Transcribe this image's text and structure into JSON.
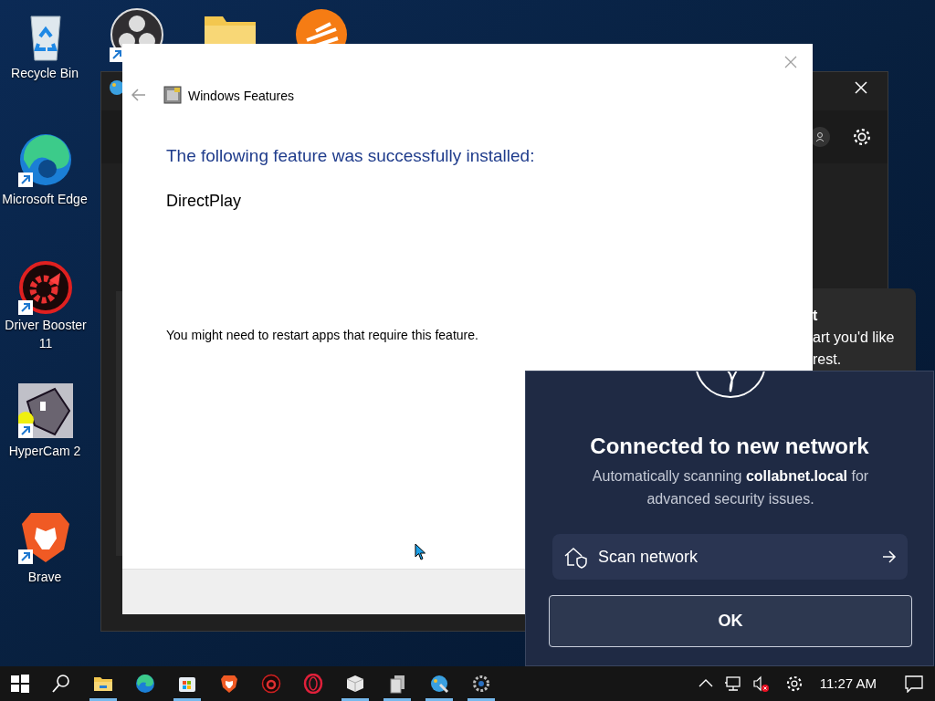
{
  "desktop": {
    "icons": [
      {
        "kind": "recycle",
        "label": "Recycle Bin",
        "shortcut": false
      },
      {
        "kind": "edge",
        "label": "Microsoft Edge",
        "shortcut": true
      },
      {
        "kind": "booster",
        "label": "Driver Booster 11",
        "shortcut": true
      },
      {
        "kind": "hypercam",
        "label": "HyperCam 2",
        "shortcut": true
      },
      {
        "kind": "brave",
        "label": "Brave",
        "shortcut": true
      },
      {
        "kind": "obs",
        "shortcut": true
      },
      {
        "kind": "folder",
        "shortcut": false
      },
      {
        "kind": "orange",
        "shortcut": false
      }
    ]
  },
  "dialog": {
    "title": "Windows Features",
    "heading": "The following feature was successfully installed:",
    "feature": "DirectPlay",
    "note": "You might need to restart apps that require this feature."
  },
  "toast": {
    "lines": [
      "t",
      "art you'd like",
      "rest."
    ]
  },
  "network_popup": {
    "title": "Connected to new network",
    "message": "Automatically scanning **collabnet.local** for advanced security issues.",
    "action": "Scan network",
    "ok": "OK"
  },
  "taskbar": {
    "apps": [
      {
        "kind": "explorer",
        "running": true
      },
      {
        "kind": "edge",
        "running": false
      },
      {
        "kind": "store",
        "running": true
      },
      {
        "kind": "brave",
        "running": false
      },
      {
        "kind": "booster",
        "running": false
      },
      {
        "kind": "opera",
        "running": false
      },
      {
        "kind": "cube",
        "running": true
      },
      {
        "kind": "doc",
        "running": true
      },
      {
        "kind": "paint",
        "running": true
      },
      {
        "kind": "gear",
        "running": true
      }
    ],
    "clock": "11:27 AM"
  }
}
